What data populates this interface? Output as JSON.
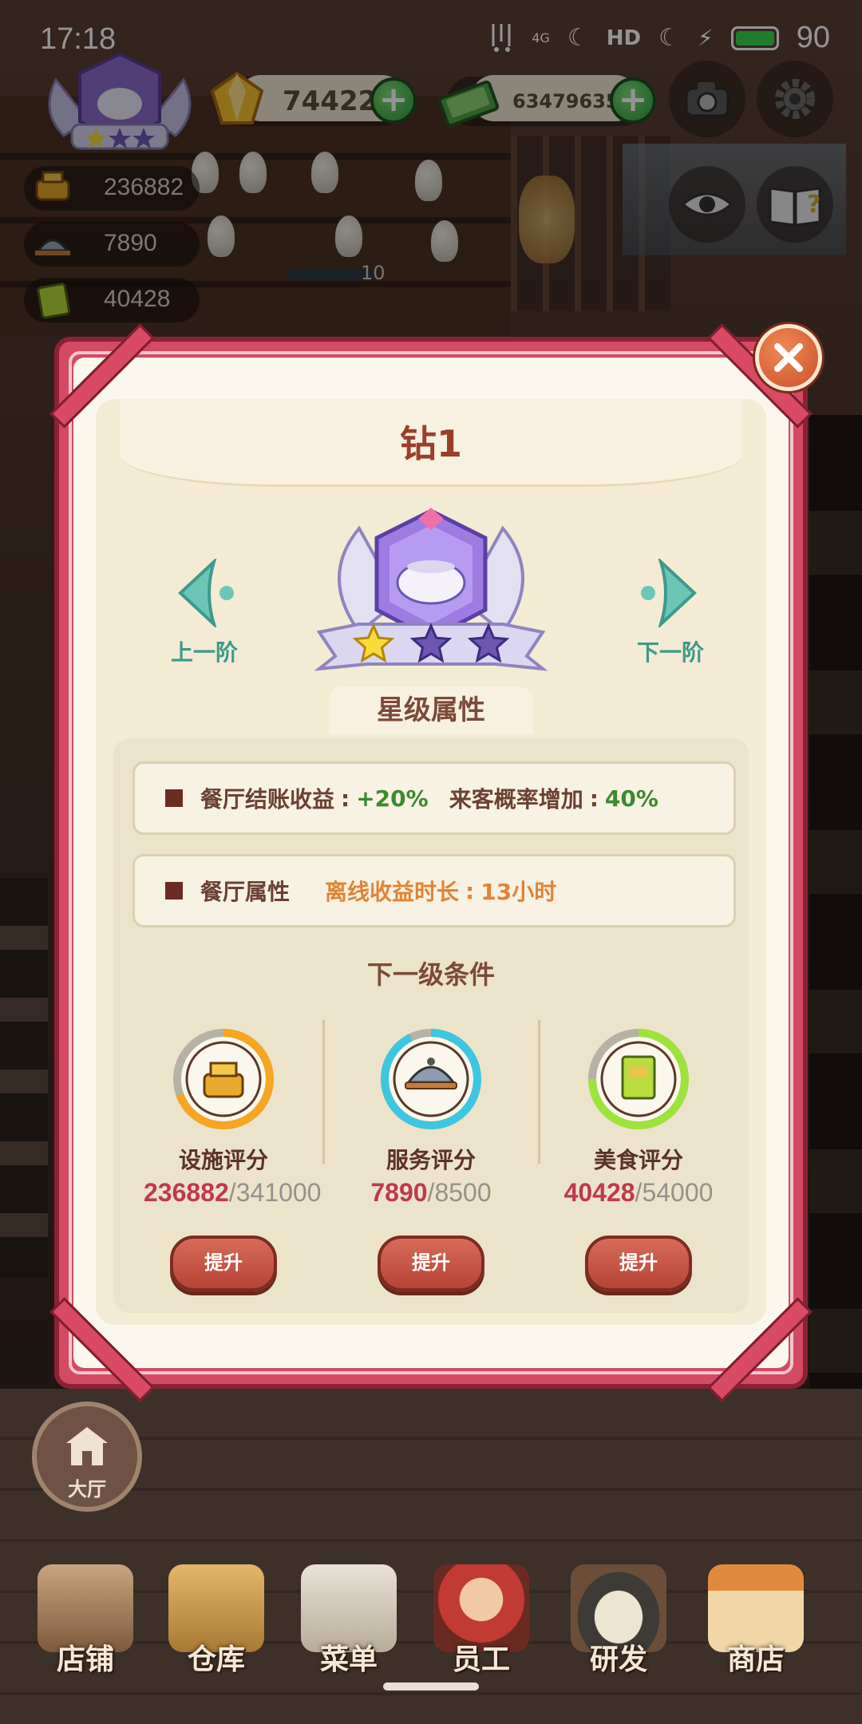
{
  "status_bar": {
    "time": "17:18",
    "network": "4G",
    "hd": "HD",
    "battery": "90",
    "icons": [
      "signal-icon",
      "call-hd-icon",
      "charging-icon",
      "battery-icon"
    ]
  },
  "hud": {
    "diamond_count": "74422",
    "cash_count": "634796358",
    "facility_score": "236882",
    "service_score": "7890",
    "food_score": "40428",
    "shelf_count": "10",
    "icons": [
      "camera-icon",
      "settings-icon",
      "eye-icon",
      "guide-book-icon"
    ]
  },
  "modal": {
    "rank_title": "钻1",
    "prev_label": "上一阶",
    "next_label": "下一阶",
    "star_section_title": "星级属性",
    "attributes": [
      {
        "label": "餐厅结账收益",
        "sep": ":",
        "value": "+20%",
        "label2": "来客概率增加",
        "sep2": ":",
        "value2": "40%"
      },
      {
        "label": "餐厅属性",
        "label2": "离线收益时长",
        "sep2": ":",
        "value2": "13小时"
      }
    ],
    "next_level_title": "下一级条件",
    "conditions": [
      {
        "label": "设施评分",
        "current": "236882",
        "sep": "/",
        "required": "341000",
        "button": "提升",
        "progress": 0.695,
        "ring_color": "#f5a623"
      },
      {
        "label": "服务评分",
        "current": "7890",
        "sep": "/",
        "required": "8500",
        "button": "提升",
        "progress": 0.928,
        "ring_color": "#3ec6e0"
      },
      {
        "label": "美食评分",
        "current": "40428",
        "sep": "/",
        "required": "54000",
        "button": "提升",
        "progress": 0.749,
        "ring_color": "#9ee33b"
      }
    ],
    "stars_filled": 1,
    "stars_total": 3
  },
  "hall_button": {
    "label": "大厅"
  },
  "bottom_nav": [
    {
      "label": "店铺"
    },
    {
      "label": "仓库"
    },
    {
      "label": "菜单"
    },
    {
      "label": "员工"
    },
    {
      "label": "研发"
    },
    {
      "label": "商店"
    }
  ],
  "colors": {
    "frame": "#d34a63",
    "paper": "#f3ebd3",
    "accent_teal": "#3d9a8d",
    "value_green": "#3d8a2e",
    "value_orange": "#e08436",
    "progress_red": "#c0394b"
  }
}
